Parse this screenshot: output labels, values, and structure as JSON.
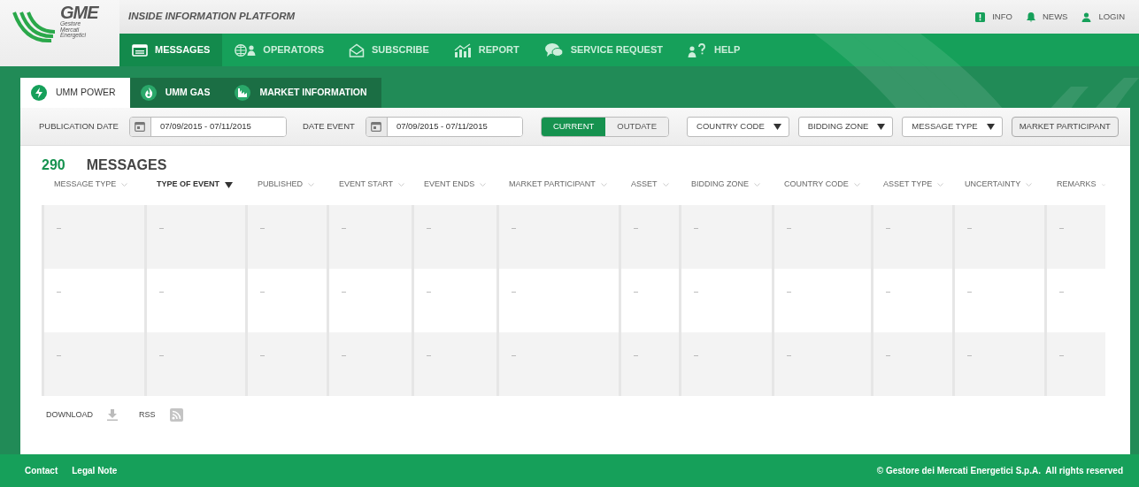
{
  "header": {
    "title": "INSIDE INFORMATION PLATFORM",
    "logo": {
      "name": "GME",
      "lines": [
        "Gestore",
        "Mercati",
        "Energetici"
      ]
    },
    "links": [
      {
        "label": "INFO",
        "kind": "info"
      },
      {
        "label": "NEWS",
        "kind": "news"
      },
      {
        "label": "LOGIN",
        "kind": "login"
      }
    ]
  },
  "nav": [
    {
      "label": "MESSAGES",
      "kind": "messages",
      "selected": true
    },
    {
      "label": "OPERATORS",
      "kind": "operators",
      "selected": false
    },
    {
      "label": "SUBSCRIBE",
      "kind": "subscribe",
      "selected": false
    },
    {
      "label": "REPORT",
      "kind": "report",
      "selected": false
    },
    {
      "label": "SERVICE REQUEST",
      "kind": "service",
      "selected": false
    },
    {
      "label": "HELP",
      "kind": "help",
      "selected": false
    }
  ],
  "tabs": [
    {
      "label": "UMM POWER",
      "kind": "power",
      "selected": true
    },
    {
      "label": "UMM GAS",
      "kind": "gas",
      "selected": false
    },
    {
      "label": "MARKET INFORMATION",
      "kind": "market",
      "selected": false
    }
  ],
  "filters": {
    "dates": [
      {
        "label": "PUBLICATION DATE",
        "value": "07/09/2015 - 07/11/2015"
      },
      {
        "label": "DATE EVENT",
        "value": "07/09/2015 - 07/11/2015"
      }
    ],
    "toggle": [
      {
        "label": "CURRENT",
        "selected": true
      },
      {
        "label": "OUTDATE",
        "selected": false
      }
    ],
    "dropdowns": [
      "COUNTRY CODE",
      "BIDDING ZONE",
      "MESSAGE TYPE"
    ],
    "button": "MARKET PARTICIPANT"
  },
  "count": "290",
  "heading": "MESSAGES",
  "table": {
    "columns": [
      {
        "label": "MESSAGE TYPE",
        "sorted": false
      },
      {
        "label": "TYPE OF EVENT",
        "sorted": true
      },
      {
        "label": "PUBLISHED",
        "sorted": false
      },
      {
        "label": "EVENT START",
        "sorted": false
      },
      {
        "label": "EVENT ENDS",
        "sorted": false
      },
      {
        "label": "MARKET PARTICIPANT",
        "sorted": false
      },
      {
        "label": "ASSET",
        "sorted": false
      },
      {
        "label": "BIDDING ZONE",
        "sorted": false
      },
      {
        "label": "COUNTRY CODE",
        "sorted": false
      },
      {
        "label": "ASSET TYPE",
        "sorted": false
      },
      {
        "label": "UNCERTAINTY",
        "sorted": false
      },
      {
        "label": "REMARKS",
        "sorted": false
      }
    ],
    "rows": [
      [
        "–",
        "–",
        "–",
        "–",
        "–",
        "–",
        "–",
        "–",
        "–",
        "–",
        "–",
        "–"
      ],
      [
        "–",
        "–",
        "–",
        "–",
        "–",
        "–",
        "–",
        "–",
        "–",
        "–",
        "–",
        "–"
      ],
      [
        "–",
        "–",
        "–",
        "–",
        "–",
        "–",
        "–",
        "–",
        "–",
        "–",
        "–",
        "–"
      ]
    ]
  },
  "actions": [
    {
      "label": "DOWNLOAD",
      "kind": "download"
    },
    {
      "label": "RSS",
      "kind": "rss"
    }
  ],
  "footer": {
    "links": [
      "Contact",
      "Legal Note"
    ],
    "copyright": "© Gestore dei Mercati Energetici S.p.A.  All rights reserved"
  }
}
